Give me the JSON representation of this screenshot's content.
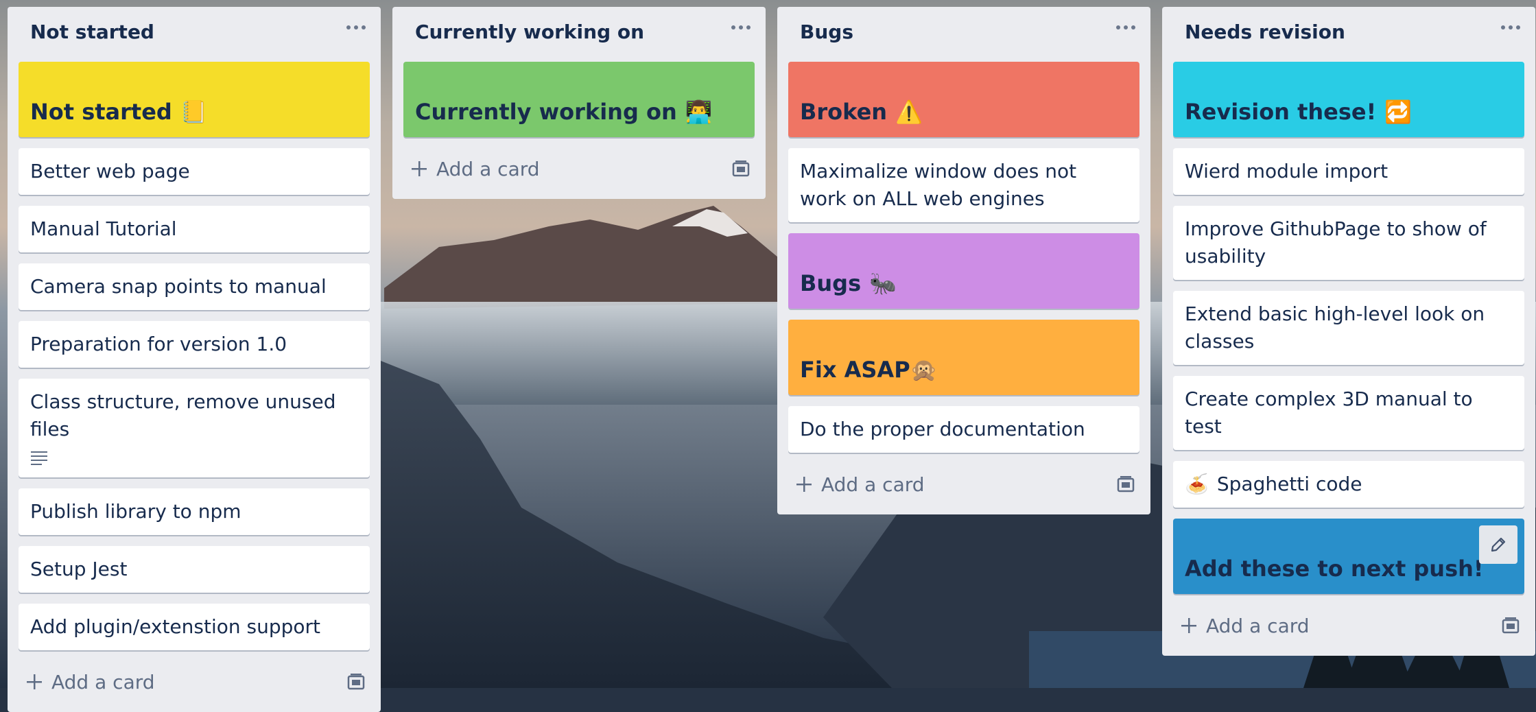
{
  "colors": {
    "list_bg": "#ebecf0",
    "text": "#172b4d",
    "muted": "#5e6c84",
    "yellow": "#f5dd29",
    "green": "#7bc86c",
    "red": "#ef7564",
    "purple": "#cd8de5",
    "orange": "#ffaf3f",
    "cyan": "#29cce5",
    "blue": "#298fca"
  },
  "lists": [
    {
      "title": "Not started",
      "menu_icon": "more-horizontal-icon",
      "cover": {
        "label": "Not started",
        "emoji": "📒",
        "color": "#f5dd29"
      },
      "cards": [
        "Better web page",
        "Manual Tutorial",
        "Camera snap points to manual",
        "Preparation for version 1.0",
        "Class structure, remove unused files",
        "Publish library to npm",
        "Setup Jest",
        "Add plugin/extenstion support"
      ],
      "add_card": "Add a card"
    },
    {
      "title": "Currently working on",
      "menu_icon": "more-horizontal-icon",
      "cover": {
        "label": "Currently working on",
        "emoji": "👨‍💻",
        "color": "#7bc86c"
      },
      "add_card": "Add a card"
    },
    {
      "title": "Bugs",
      "menu_icon": "more-horizontal-icon",
      "cover": {
        "label": "Broken",
        "emoji": "⚠️",
        "color": "#ef7564"
      },
      "card_1": "Maximalize window does not work on ALL web engines",
      "cover_2": {
        "label": "Bugs",
        "emoji": "🐜",
        "color": "#cd8de5"
      },
      "cover_3": {
        "label": "Fix ASAP",
        "emoji": "🙊",
        "color": "#ffaf3f"
      },
      "card_2": "Do the proper documentation",
      "add_card": "Add a card"
    },
    {
      "title": "Needs revision",
      "menu_icon": "more-horizontal-icon",
      "cover": {
        "label": "Revision these!",
        "emoji": "🔁",
        "color": "#29cce5"
      },
      "cards": [
        "Wierd module import",
        "Improve GithubPage to show of usability",
        "Extend basic high-level look on classes",
        "Create complex 3D manual to test"
      ],
      "spaghetti": {
        "emoji": "🍝",
        "label": "Spaghetti code"
      },
      "cover_2": {
        "label": "Add these to next push!",
        "color": "#298fca"
      },
      "add_card": "Add a card"
    }
  ]
}
